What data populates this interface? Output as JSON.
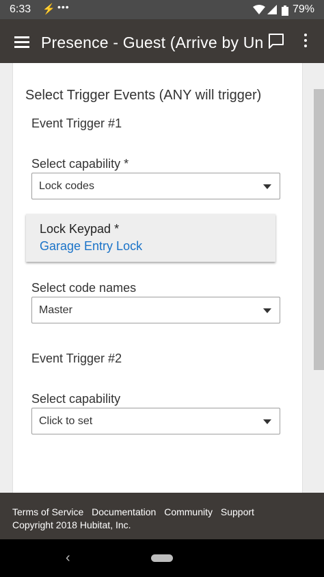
{
  "status_bar": {
    "time": "6:33",
    "battery_pct": "79%",
    "icons": [
      "charging-bolt-icon",
      "more-notifications-icon",
      "wifi-icon",
      "signal-icon",
      "battery-icon"
    ]
  },
  "app_bar": {
    "title": "Presence - Guest (Arrive by Un",
    "icons": [
      "menu-icon",
      "feedback-icon",
      "more-vert-icon"
    ],
    "background": "#3e3a37"
  },
  "form": {
    "section_title": "Select Trigger Events (ANY will trigger)",
    "triggers": [
      {
        "heading": "Event Trigger #1",
        "capability_label": "Select capability *",
        "capability_value": "Lock codes",
        "device_label": "Lock Keypad *",
        "device_value": "Garage Entry Lock",
        "codes_label": "Select code names",
        "codes_value": "Master"
      },
      {
        "heading": "Event Trigger #2",
        "capability_label": "Select capability",
        "capability_value": "Click to set"
      }
    ]
  },
  "footer": {
    "links": [
      "Terms of Service",
      "Documentation",
      "Community",
      "Support"
    ],
    "copyright": "Copyright 2018 Hubitat, Inc."
  },
  "colors": {
    "link": "#1a73c8",
    "bars": "#3e3a37"
  }
}
